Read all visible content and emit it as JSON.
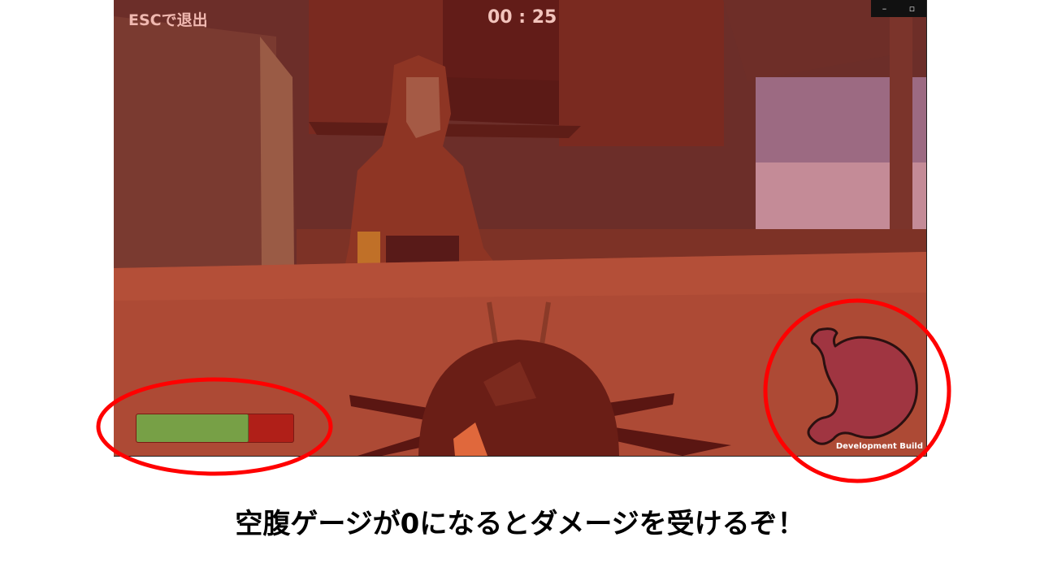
{
  "hud": {
    "exit_hint": "ESCで退出",
    "timer": "00 : 25",
    "dev_build": "Development Build",
    "hunger_gauge": {
      "value_fraction": 0.71,
      "fill_color": "#77a046",
      "empty_color": "#b01f18"
    }
  },
  "window_controls": {
    "minimize": "–",
    "restore": "▫"
  },
  "caption": "空腹ゲージが0になるとダメージを受けるぞ！",
  "colors": {
    "highlight_ring": "#ff0000",
    "stomach": "#a03541"
  },
  "icons": [
    "stomach-icon",
    "beetle-player",
    "minimize-icon",
    "restore-icon"
  ]
}
